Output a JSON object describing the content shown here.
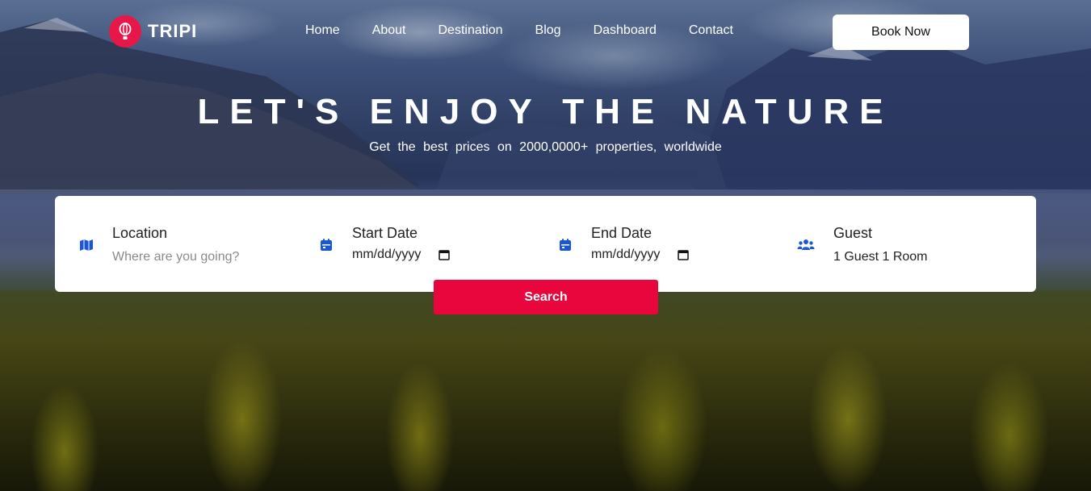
{
  "brand": {
    "name": "TRIPI",
    "logo_icon": "hot-air-balloon-icon",
    "accent": "#e8174a"
  },
  "nav": {
    "items": [
      {
        "label": "Home"
      },
      {
        "label": "About"
      },
      {
        "label": "Destination"
      },
      {
        "label": "Blog"
      },
      {
        "label": "Dashboard"
      },
      {
        "label": "Contact"
      }
    ],
    "book_label": "Book Now"
  },
  "hero": {
    "title": "LET'S ENJOY THE NATURE",
    "subtitle": "Get the best prices on 2000,0000+ properties, worldwide"
  },
  "search": {
    "location": {
      "label": "Location",
      "placeholder": "Where are you going?",
      "icon": "map-icon"
    },
    "start_date": {
      "label": "Start Date",
      "value": "mm/dd/yyyy",
      "icon": "calendar-icon"
    },
    "end_date": {
      "label": "End Date",
      "value": "mm/dd/yyyy",
      "icon": "calendar-icon"
    },
    "guest": {
      "label": "Guest",
      "value": "1 Guest 1 Room",
      "icon": "users-icon"
    },
    "button_label": "Search",
    "icon_color": "#1a56db",
    "button_color": "#e8063c"
  }
}
